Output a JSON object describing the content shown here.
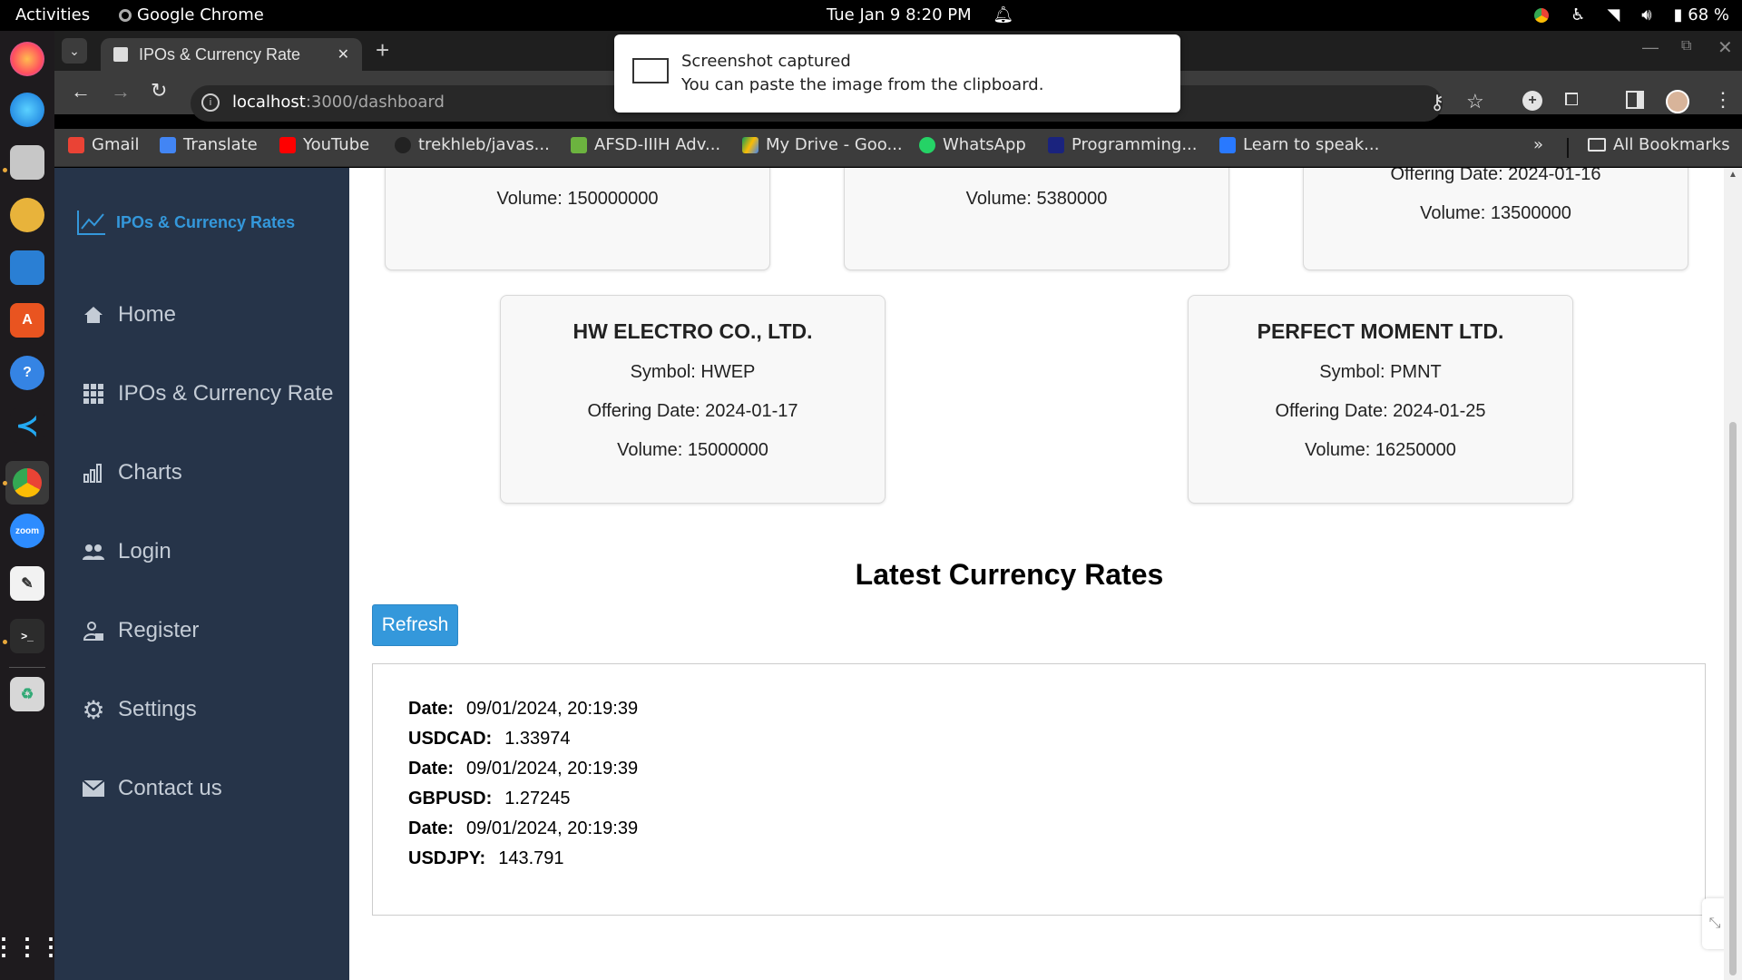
{
  "topbar": {
    "activities": "Activities",
    "app_name": "Google Chrome",
    "clock": "Tue Jan 9  8:20 PM",
    "battery": "68 %"
  },
  "browser": {
    "tab_title": "IPOs & Currency Rate",
    "url_host": "localhost",
    "url_path": ":3000/dashboard",
    "bookmarks": [
      "Gmail",
      "Translate",
      "YouTube",
      "trekhleb/javas...",
      "AFSD-IIIH Adv...",
      "My Drive - Goo...",
      "WhatsApp",
      "Programming...",
      "Learn to speak..."
    ],
    "all_bookmarks": "All Bookmarks"
  },
  "notification": {
    "title": "Screenshot captured",
    "body": "You can paste the image from the clipboard."
  },
  "sidebar": {
    "brand": "IPOs & Currency Rates",
    "items": [
      {
        "label": "Home",
        "icon": "home-icon"
      },
      {
        "label": "IPOs & Currency Rate",
        "icon": "grid-icon"
      },
      {
        "label": "Charts",
        "icon": "bar-chart-icon"
      },
      {
        "label": "Login",
        "icon": "users-icon"
      },
      {
        "label": "Register",
        "icon": "user-add-icon"
      },
      {
        "label": "Settings",
        "icon": "gear-icon"
      },
      {
        "label": "Contact us",
        "icon": "envelope-icon"
      }
    ]
  },
  "ipo_cards_partial": [
    {
      "volume": "Volume: 150000000"
    },
    {
      "volume": "Volume: 5380000"
    },
    {
      "offering_date": "Offering Date: 2024-01-16",
      "volume": "Volume: 13500000"
    }
  ],
  "ipo_cards": [
    {
      "name": "HW ELECTRO CO., LTD.",
      "symbol": "Symbol: HWEP",
      "offering_date": "Offering Date: 2024-01-17",
      "volume": "Volume: 15000000"
    },
    {
      "name": "PERFECT MOMENT LTD.",
      "symbol": "Symbol: PMNT",
      "offering_date": "Offering Date: 2024-01-25",
      "volume": "Volume: 16250000"
    }
  ],
  "currency": {
    "title": "Latest Currency Rates",
    "refresh_label": "Refresh",
    "rows": [
      {
        "label": "Date:",
        "value": "09/01/2024, 20:19:39"
      },
      {
        "label": "USDCAD:",
        "value": "1.33974"
      },
      {
        "label": "Date:",
        "value": "09/01/2024, 20:19:39"
      },
      {
        "label": "GBPUSD:",
        "value": "1.27245"
      },
      {
        "label": "Date:",
        "value": "09/01/2024, 20:19:39"
      },
      {
        "label": "USDJPY:",
        "value": "143.791"
      }
    ]
  },
  "colors": {
    "sidebar_bg": "#263449",
    "accent": "#3498db"
  }
}
